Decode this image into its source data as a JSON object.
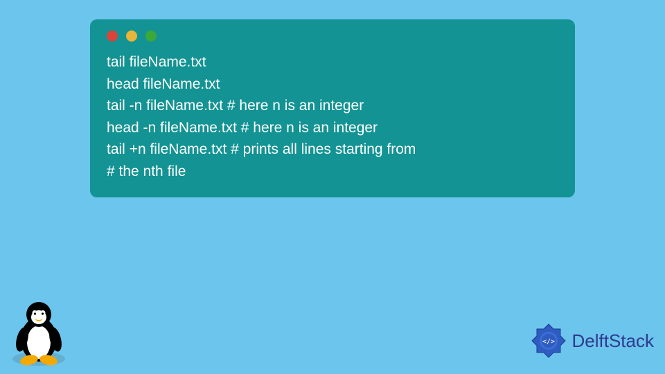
{
  "terminal": {
    "lines": [
      "tail fileName.txt",
      "head fileName.txt",
      "tail -n fileName.txt # here n is an integer",
      "head -n fileName.txt # here n is an integer",
      "tail +n fileName.txt # prints all lines starting from",
      "# the nth file"
    ]
  },
  "brand": {
    "name": "DelftStack"
  },
  "icons": {
    "red": "#d9453a",
    "yellow": "#e9b43a",
    "green": "#3aa93a"
  }
}
